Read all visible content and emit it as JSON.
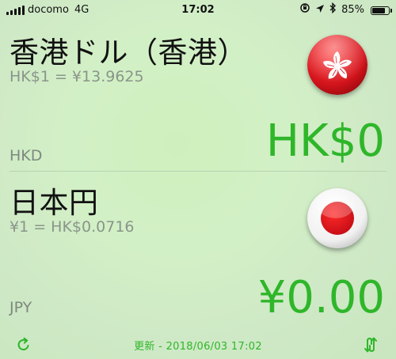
{
  "status_bar": {
    "carrier": "docomo",
    "network": "4G",
    "time": "17:02",
    "battery_text": "85%",
    "battery_level": 0.85,
    "icons": [
      "orientation-lock-icon",
      "location-arrow-icon",
      "bluetooth-icon"
    ]
  },
  "currencies": [
    {
      "name": "香港ドル（香港）",
      "rate": "HK$1 = ¥13.9625",
      "code": "HKD",
      "amount": "HK$0",
      "flag": "hong-kong-flag-icon"
    },
    {
      "name": "日本円",
      "rate": "¥1 = HK$0.0716",
      "code": "JPY",
      "amount": "¥0.00",
      "flag": "japan-flag-icon"
    }
  ],
  "toolbar": {
    "updated": "更新 - 2018/06/03 17:02",
    "refresh_icon": "refresh-icon",
    "swap_icon": "swap-icon"
  },
  "colors": {
    "accent": "#2fb62a",
    "flag_red": "#d4141c",
    "secondary_text": "#8a958a"
  }
}
